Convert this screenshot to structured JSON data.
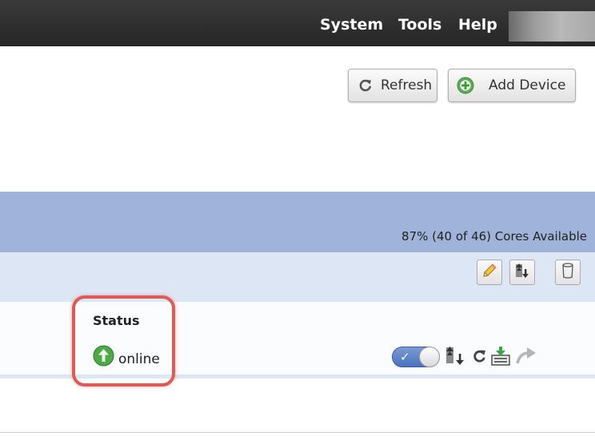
{
  "menu": {
    "items": [
      "System",
      "Tools",
      "Help"
    ]
  },
  "toolbar": {
    "refresh_label": "Refresh",
    "add_device_label": "Add Device"
  },
  "group": {
    "cores_available": "87% (40 of 46) Cores Available"
  },
  "device_table": {
    "columns": [
      "Status"
    ],
    "rows": [
      {
        "status": "online"
      }
    ]
  },
  "icons": {
    "refresh": "refresh-icon",
    "add": "plus-circle-icon",
    "edit": "pencil-icon",
    "update": "upgrade-icon",
    "delete": "trash-icon",
    "status_online": "arrow-up-circle-icon",
    "toggle": "toggle-switch-icon",
    "reapply": "reapply-icon",
    "deploy": "deploy-icon",
    "move": "move-arrow-icon"
  },
  "colors": {
    "menu_bar": "#2e2e2e",
    "group_header": "#9fb4d8",
    "action_bar": "#dde6f5",
    "highlight": "#dd5a55",
    "online_green": "#4ea846",
    "toggle_blue": "#5b80c6"
  },
  "state": {
    "device_enabled": true
  }
}
